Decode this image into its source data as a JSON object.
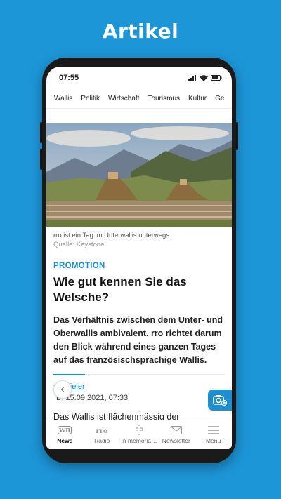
{
  "header": {
    "title": "Artikel"
  },
  "status": {
    "time": "07:55"
  },
  "categories": [
    "Wallis",
    "Politik",
    "Wirtschaft",
    "Tourismus",
    "Kultur",
    "Ge"
  ],
  "image": {
    "caption": "rro ist ein Tag im Unterwallis unterwegs.",
    "source": "Quelle: Keystone"
  },
  "article": {
    "kicker": "PROMOTION",
    "title": "Wie gut kennen Sie das Welsche?",
    "lead": "Das Verhältnis zwischen dem Unter- und Oberwallis ambivalent. rro richtet darum den Blick während eines ganzen Tages auf das französischsprachige Wallis.",
    "author": "rro Bieler",
    "date": "Di 15.09.2021, 07:33",
    "body_start": "Das Wallis ist flächenmässig der"
  },
  "bottom_nav": [
    {
      "label": "News",
      "icon": "wb-logo-icon",
      "active": true
    },
    {
      "label": "Radio",
      "icon": "rro-logo-icon",
      "active": false
    },
    {
      "label": "In memoria…",
      "icon": "cross-icon",
      "active": false
    },
    {
      "label": "Newsletter",
      "icon": "mail-icon",
      "active": false
    },
    {
      "label": "Menü",
      "icon": "hamburger-icon",
      "active": false
    }
  ],
  "colors": {
    "brand": "#1d96d8",
    "accent": "#1d8fd0"
  }
}
